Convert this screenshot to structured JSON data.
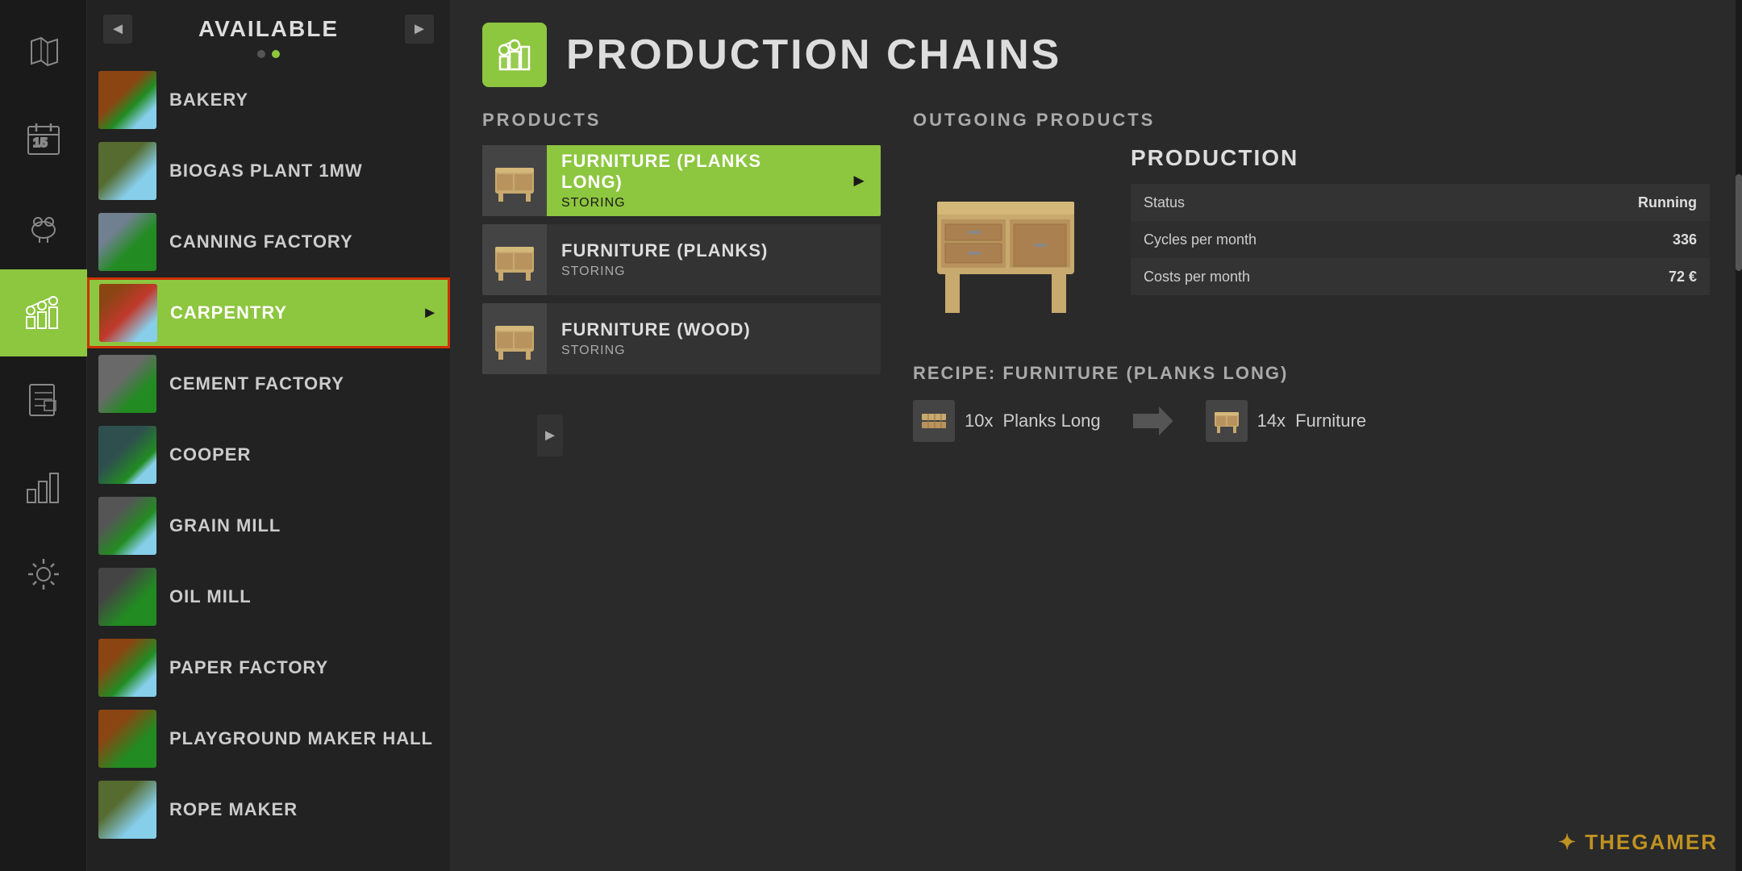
{
  "sidebar": {
    "items": [
      {
        "id": "map",
        "label": "Map",
        "icon": "map"
      },
      {
        "id": "calendar",
        "label": "Calendar",
        "icon": "calendar"
      },
      {
        "id": "animals",
        "label": "Animals",
        "icon": "animals"
      },
      {
        "id": "production",
        "label": "Production",
        "icon": "production",
        "active": true
      },
      {
        "id": "reports",
        "label": "Reports",
        "icon": "reports"
      },
      {
        "id": "stats",
        "label": "Statistics",
        "icon": "stats"
      },
      {
        "id": "settings",
        "label": "Settings",
        "icon": "settings"
      }
    ]
  },
  "buildingsPanel": {
    "title": "AVAILABLE",
    "navPrev": "◄",
    "navNext": "►",
    "pages": 2,
    "activePage": 1,
    "items": [
      {
        "id": "bakery",
        "name": "BAKERY",
        "thumb": "bakery"
      },
      {
        "id": "biogas",
        "name": "BIOGAS PLANT 1MW",
        "thumb": "biogas"
      },
      {
        "id": "canning",
        "name": "CANNING FACTORY",
        "thumb": "canning"
      },
      {
        "id": "carpentry",
        "name": "CARPENTRY",
        "thumb": "carpentry",
        "selected": true
      },
      {
        "id": "cement",
        "name": "CEMENT FACTORY",
        "thumb": "cement"
      },
      {
        "id": "cooper",
        "name": "COOPER",
        "thumb": "cooper"
      },
      {
        "id": "grain",
        "name": "GRAIN MILL",
        "thumb": "grain"
      },
      {
        "id": "oil",
        "name": "OIL MILL",
        "thumb": "oil"
      },
      {
        "id": "paper",
        "name": "PAPER FACTORY",
        "thumb": "paper"
      },
      {
        "id": "playground",
        "name": "PLAYGROUND MAKER HALL",
        "thumb": "playground"
      },
      {
        "id": "rope",
        "name": "ROPE MAKER",
        "thumb": "rope"
      }
    ]
  },
  "mainPanel": {
    "title": "PRODUCTION CHAINS",
    "icon": "factory-icon"
  },
  "products": {
    "label": "PRODUCTS",
    "items": [
      {
        "id": "furniture-planks-long",
        "name": "FURNITURE (PLANKS LONG)",
        "status": "STORING",
        "active": true
      },
      {
        "id": "furniture-planks",
        "name": "FURNITURE (PLANKS)",
        "status": "STORING",
        "active": false
      },
      {
        "id": "furniture-wood",
        "name": "FURNITURE (WOOD)",
        "status": "STORING",
        "active": false
      }
    ]
  },
  "outgoing": {
    "label": "OUTGOING PRODUCTS",
    "production": {
      "title": "PRODUCTION",
      "rows": [
        {
          "label": "Status",
          "value": "Running",
          "isStatus": true
        },
        {
          "label": "Cycles per month",
          "value": "336"
        },
        {
          "label": "Costs per month",
          "value": "72 €"
        }
      ]
    },
    "recipe": {
      "title": "RECIPE: FURNITURE (PLANKS LONG)",
      "input": {
        "amount": "10x",
        "item": "Planks Long"
      },
      "output": {
        "amount": "14x",
        "item": "Furniture"
      }
    }
  },
  "watermark": {
    "symbol": "✦",
    "text": "THEGAMER"
  }
}
